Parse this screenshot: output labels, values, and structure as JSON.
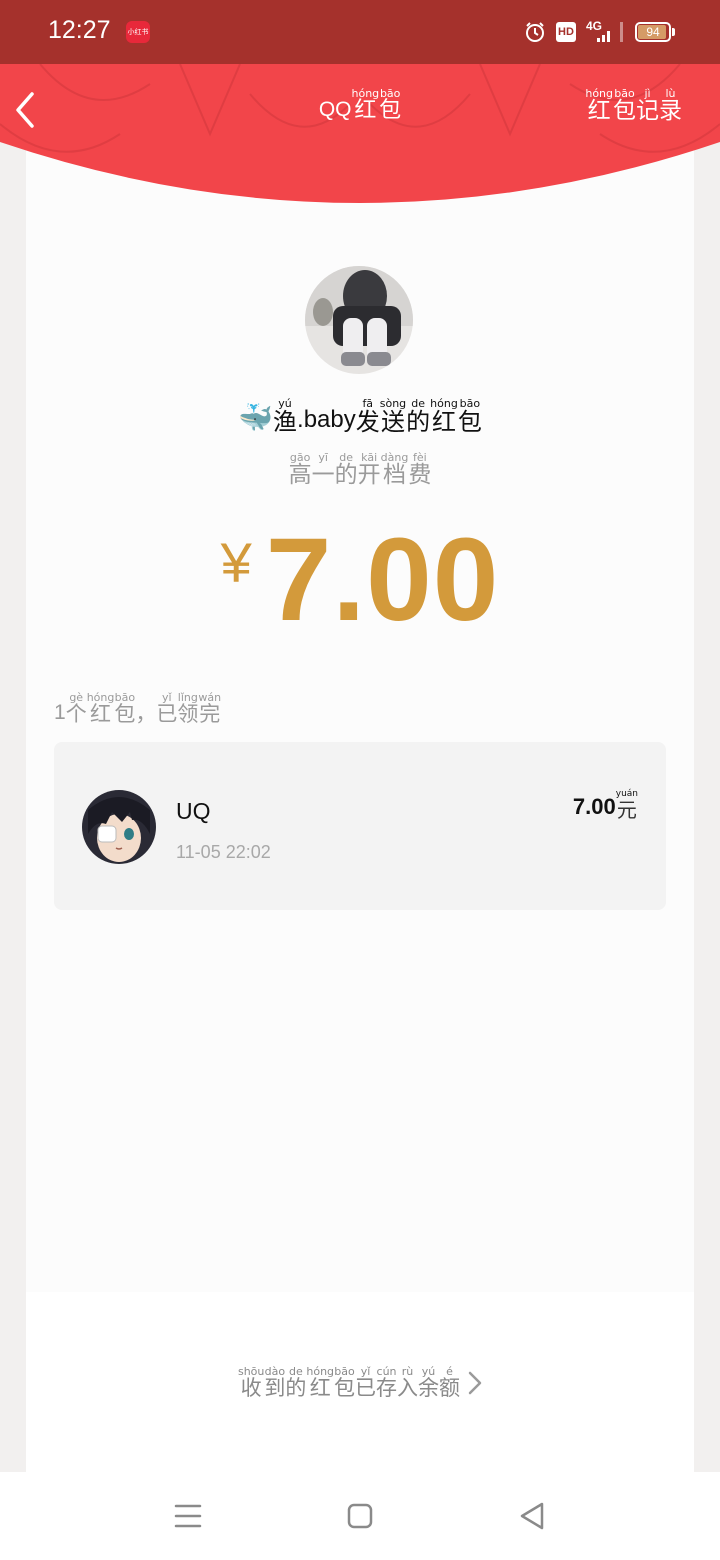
{
  "status_bar": {
    "time": "12:27",
    "app_badge": "小红书",
    "hd": "HD",
    "network": "4G",
    "battery": 94,
    "battery_label": "94"
  },
  "header": {
    "back_icon": "chevron-left-icon",
    "title_prefix": "QQ",
    "title_chars": [
      {
        "py": "hóng",
        "hz": "红"
      },
      {
        "py": "bāo",
        "hz": "包"
      }
    ],
    "records_chars": [
      {
        "py": "hóng",
        "hz": "红"
      },
      {
        "py": "bāo",
        "hz": "包"
      },
      {
        "py": "jì",
        "hz": "记"
      },
      {
        "py": "lù",
        "hz": "录"
      }
    ],
    "color": "#f2454a"
  },
  "sender": {
    "emoji": "🐳",
    "name_first": {
      "py": "yú",
      "hz": "渔"
    },
    "name_latin": ".baby",
    "suffix_chars": [
      {
        "py": "fā",
        "hz": "发"
      },
      {
        "py": "sòng",
        "hz": "送"
      },
      {
        "py": "de",
        "hz": "的"
      },
      {
        "py": "hóng",
        "hz": "红"
      },
      {
        "py": "bāo",
        "hz": "包"
      }
    ]
  },
  "message_chars": [
    {
      "py": "gāo",
      "hz": "高"
    },
    {
      "py": "yī",
      "hz": "一"
    },
    {
      "py": "de",
      "hz": "的"
    },
    {
      "py": "kāi",
      "hz": "开"
    },
    {
      "py": "dàng",
      "hz": "档"
    },
    {
      "py": "fèi",
      "hz": "费"
    }
  ],
  "amount": {
    "currency": "¥",
    "value": "7.00",
    "color": "#d39a3b"
  },
  "summary": {
    "count": "1",
    "chars": [
      {
        "py": "gè",
        "hz": "个"
      },
      {
        "py": "hóng",
        "hz": "红"
      },
      {
        "py": "bāo",
        "hz": "包"
      },
      {
        "py": "",
        "hz": "，"
      },
      {
        "py": "yǐ",
        "hz": "已"
      },
      {
        "py": "lǐng",
        "hz": "领"
      },
      {
        "py": "wán",
        "hz": "完"
      }
    ]
  },
  "receivers": [
    {
      "name": "UQ",
      "time": "11-05  22:02",
      "amount": "7.00",
      "unit": {
        "py": "yuán",
        "hz": "元"
      }
    }
  ],
  "footer": {
    "chars": [
      {
        "py": "shōu",
        "hz": "收"
      },
      {
        "py": "dào",
        "hz": "到"
      },
      {
        "py": "de",
        "hz": "的"
      },
      {
        "py": "hóng",
        "hz": "红"
      },
      {
        "py": "bāo",
        "hz": "包"
      },
      {
        "py": "yǐ",
        "hz": "已"
      },
      {
        "py": "cún",
        "hz": "存"
      },
      {
        "py": "rù",
        "hz": "入"
      },
      {
        "py": "yú",
        "hz": "余"
      },
      {
        "py": "é",
        "hz": "额"
      }
    ],
    "chevron_icon": "chevron-right-icon"
  },
  "nav": {
    "menu_icon": "menu-icon",
    "home_icon": "home-square-icon",
    "back_icon": "back-triangle-icon"
  }
}
